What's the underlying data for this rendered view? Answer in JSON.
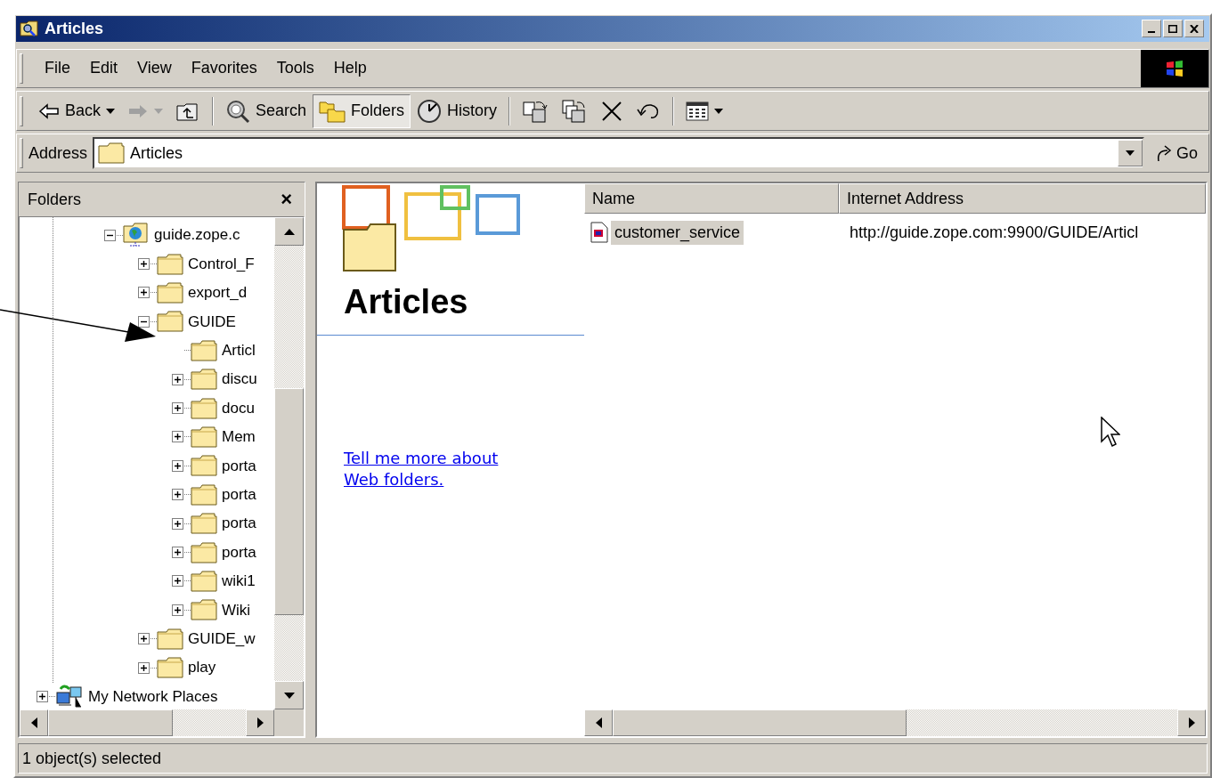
{
  "window": {
    "title": "Articles"
  },
  "menu": [
    {
      "label": "File"
    },
    {
      "label": "Edit"
    },
    {
      "label": "View"
    },
    {
      "label": "Favorites"
    },
    {
      "label": "Tools"
    },
    {
      "label": "Help"
    }
  ],
  "toolbar": {
    "groups": [
      [
        {
          "kind": "back",
          "label": "Back",
          "dropdown": true,
          "disabled": false,
          "selected": false
        },
        {
          "kind": "forward",
          "dropdown": true,
          "disabled": true,
          "selected": false
        },
        {
          "kind": "up",
          "dropdown": false,
          "disabled": false,
          "selected": false
        }
      ],
      [
        {
          "kind": "search",
          "label": "Search",
          "dropdown": false,
          "disabled": false,
          "selected": false
        },
        {
          "kind": "folders",
          "label": "Folders",
          "dropdown": false,
          "disabled": false,
          "selected": true
        },
        {
          "kind": "history",
          "label": "History",
          "dropdown": false,
          "disabled": false,
          "selected": false
        }
      ],
      [
        {
          "kind": "move",
          "dropdown": false,
          "disabled": false,
          "selected": false
        },
        {
          "kind": "copy",
          "dropdown": false,
          "disabled": false,
          "selected": false
        },
        {
          "kind": "delete",
          "dropdown": false,
          "disabled": false,
          "selected": false
        },
        {
          "kind": "undo",
          "dropdown": false,
          "disabled": false,
          "selected": false
        }
      ],
      [
        {
          "kind": "views",
          "dropdown": true,
          "disabled": false,
          "selected": false
        }
      ]
    ]
  },
  "address": {
    "label": "Address",
    "value": "Articles",
    "go": "Go"
  },
  "folders_pane": {
    "title": "Folders",
    "close": "×"
  },
  "tree": [
    {
      "kind": "web_folder",
      "label": "guide.zope.c",
      "expandable": true,
      "expanded": true,
      "children": [
        {
          "kind": "folder",
          "label": "Control_F",
          "expandable": true,
          "expanded": false
        },
        {
          "kind": "folder",
          "label": "export_d",
          "expandable": true,
          "expanded": false
        },
        {
          "kind": "folder",
          "label": "GUIDE",
          "expandable": true,
          "expanded": true,
          "children": [
            {
              "kind": "folder",
              "label": "Articl",
              "expandable": false,
              "expanded": false
            },
            {
              "kind": "folder",
              "label": "discu",
              "expandable": true,
              "expanded": false
            },
            {
              "kind": "folder",
              "label": "docu",
              "expandable": true,
              "expanded": false
            },
            {
              "kind": "folder",
              "label": "Mem",
              "expandable": true,
              "expanded": false
            },
            {
              "kind": "folder",
              "label": "porta",
              "expandable": true,
              "expanded": false
            },
            {
              "kind": "folder",
              "label": "porta",
              "expandable": true,
              "expanded": false
            },
            {
              "kind": "folder",
              "label": "porta",
              "expandable": true,
              "expanded": false
            },
            {
              "kind": "folder",
              "label": "porta",
              "expandable": true,
              "expanded": false
            },
            {
              "kind": "folder",
              "label": "wiki1",
              "expandable": true,
              "expanded": false
            },
            {
              "kind": "folder",
              "label": "Wiki",
              "expandable": true,
              "expanded": false
            }
          ]
        },
        {
          "kind": "folder",
          "label": "GUIDE_w",
          "expandable": true,
          "expanded": false
        },
        {
          "kind": "folder",
          "label": "play",
          "expandable": true,
          "expanded": false
        }
      ]
    },
    {
      "kind": "network",
      "label": "My Network Places",
      "expandable": true,
      "expanded": false
    }
  ],
  "webview": {
    "heading": "Articles",
    "link": "Tell me more about Web folders."
  },
  "list": {
    "columns": [
      "Name",
      "Internet Address"
    ],
    "rows": [
      {
        "selected": true,
        "cells": [
          "customer_service",
          "http://guide.zope.com:9900/GUIDE/Articl"
        ]
      }
    ]
  },
  "status_bar": {
    "text": "1 object(s) selected"
  }
}
